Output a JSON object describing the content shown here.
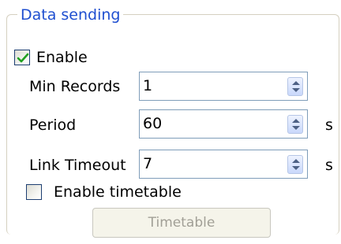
{
  "group": {
    "title": "Data sending"
  },
  "enable": {
    "label": "Enable",
    "checked": true
  },
  "fields": {
    "min_records": {
      "label": "Min Records",
      "value": "1",
      "unit": ""
    },
    "period": {
      "label": "Period",
      "value": "60",
      "unit": "s"
    },
    "link_timeout": {
      "label": "Link Timeout",
      "value": "7",
      "unit": "s"
    }
  },
  "timetable": {
    "enable_label": "Enable timetable",
    "enable_checked": false,
    "button_label": "Timetable",
    "button_enabled": false
  },
  "icons": {
    "check": "check-icon",
    "spin_arrows": "up-down-arrows-icon"
  },
  "colors": {
    "group_title": "#1f4fd0",
    "disabled_text": "#a19f96",
    "field_border": "#7f9db9"
  }
}
